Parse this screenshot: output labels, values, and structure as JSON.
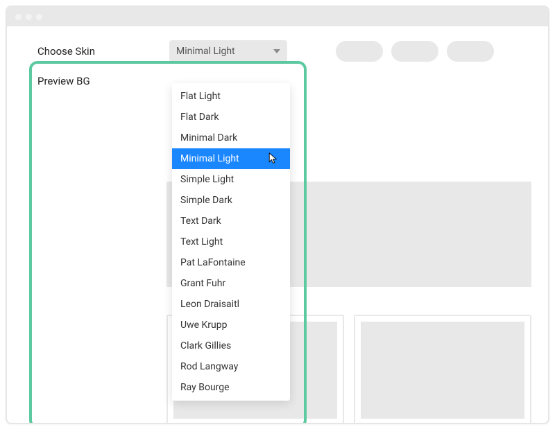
{
  "chooseSkin": {
    "label": "Choose Skin",
    "selected": "Minimal Light"
  },
  "previewBG": {
    "label": "Preview BG"
  },
  "dropdown": {
    "options": [
      "Flat Light",
      "Flat Dark",
      "Minimal Dark",
      "Minimal Light",
      "Simple Light",
      "Simple Dark",
      "Text Dark",
      "Text Light",
      "Pat LaFontaine",
      "Grant Fuhr",
      "Leon Draisaitl",
      "Uwe Krupp",
      "Clark Gillies",
      "Rod Langway",
      "Ray Bourge"
    ],
    "selectedIndex": 3
  }
}
